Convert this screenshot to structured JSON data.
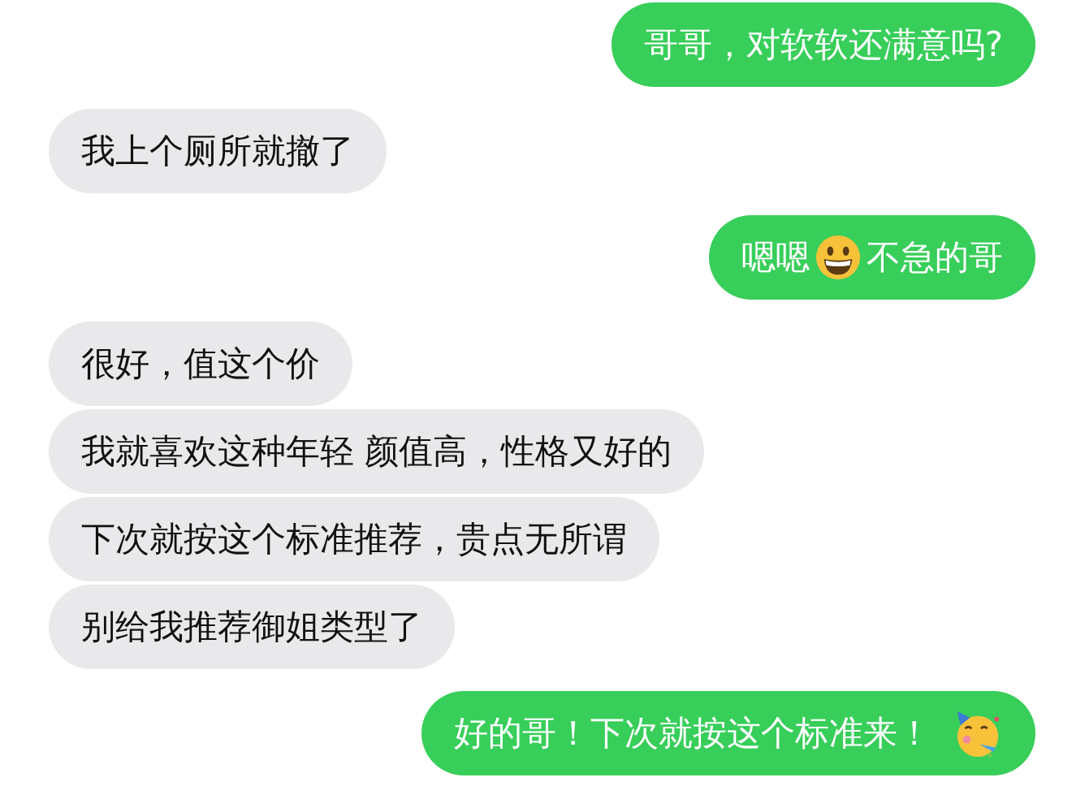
{
  "messages": [
    {
      "outgoing": true,
      "parts": [
        {
          "kind": "text",
          "text": "哥哥，对软软还满意吗?"
        }
      ]
    },
    {
      "outgoing": false,
      "parts": [
        {
          "kind": "text",
          "text": "我上个厕所就撤了"
        }
      ]
    },
    {
      "outgoing": true,
      "parts": [
        {
          "kind": "text",
          "text": "嗯嗯"
        },
        {
          "kind": "grin"
        },
        {
          "kind": "text",
          "text": "不急的哥"
        }
      ]
    },
    {
      "outgoing": false,
      "parts": [
        {
          "kind": "text",
          "text": "很好，值这个价"
        }
      ]
    },
    {
      "outgoing": false,
      "parts": [
        {
          "kind": "text",
          "text": "我就喜欢这种年轻 颜值高，性格又好的"
        }
      ]
    },
    {
      "outgoing": false,
      "parts": [
        {
          "kind": "text",
          "text": "下次就按这个标准推荐，贵点无所谓"
        }
      ]
    },
    {
      "outgoing": false,
      "parts": [
        {
          "kind": "text",
          "text": "别给我推荐御姐类型了"
        }
      ]
    },
    {
      "outgoing": true,
      "parts": [
        {
          "kind": "text",
          "text": "好的哥！下次就按这个标准来！"
        },
        {
          "kind": "party"
        }
      ]
    }
  ]
}
